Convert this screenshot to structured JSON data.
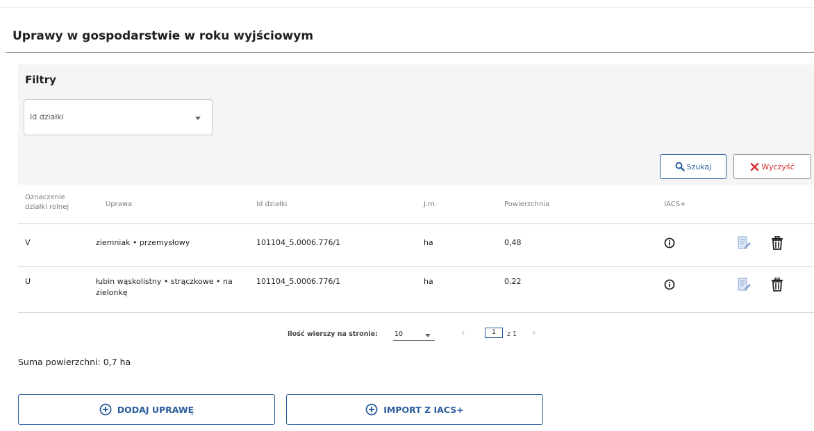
{
  "section": {
    "title": "Uprawy w gospodarstwie w roku wyjściowym"
  },
  "filters": {
    "title": "Filtry",
    "plot_select_label": "Id działki",
    "search_label": "Szukaj",
    "clear_label": "Wyczyść"
  },
  "table": {
    "headers": {
      "plot_mark": "Oznaczenie działki rolnej",
      "crop": "Uprawa",
      "plot_id": "Id działki",
      "unit": "J.m.",
      "area": "Powierzchnia",
      "iacs": "IACS+"
    },
    "rows": [
      {
        "plot_mark": "V",
        "crop": "ziemniak • przemysłowy",
        "plot_id": "101104_5.0006.776/1",
        "unit": "ha",
        "area": "0,48"
      },
      {
        "plot_mark": "U",
        "crop": "łubin wąskolistny • strączkowe • na zielonkę",
        "plot_id": "101104_5.0006.776/1",
        "unit": "ha",
        "area": "0,22"
      }
    ]
  },
  "pagination": {
    "rows_per_page_label": "Ilość wierszy na stronie:",
    "rows_per_page_value": "10",
    "current_page": "1",
    "of_pages": "z 1",
    "prev_glyph": "‹",
    "next_glyph": "›"
  },
  "summary": {
    "total_area": "Suma powierzchni: 0,7 ha"
  },
  "actions": {
    "add_crop": "DODAJ UPRAWĘ",
    "import_iacs": "IMPORT Z IACS+"
  },
  "colors": {
    "accent": "#2a5d9f",
    "danger": "#d32f2f",
    "filter_bg": "#f5f5f5"
  },
  "icons": {
    "search": "search-icon",
    "clear": "close-icon",
    "info": "info-icon",
    "edit": "edit-icon",
    "delete": "trash-icon",
    "add": "plus-circle-icon"
  }
}
